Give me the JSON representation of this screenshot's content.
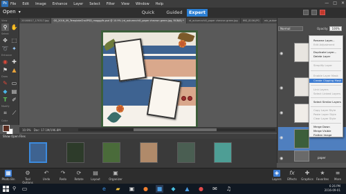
{
  "menubar": {
    "logo_text": "Ps",
    "items": [
      "File",
      "Edit",
      "Image",
      "Enhance",
      "Layer",
      "Select",
      "Filter",
      "View",
      "Window",
      "Help"
    ],
    "window_controls": [
      "—",
      "□",
      "✕"
    ]
  },
  "modebar": {
    "open_label": "Open",
    "tabs": [
      "Quick",
      "Guided",
      "Expert"
    ],
    "active_tab": "Expert"
  },
  "document_tabs": [
    {
      "label": "20160817_170317.jpg",
      "active": false
    },
    {
      "label": "GS_2016_09_TemplateChallPSD_magggifs.psd @ 10.9% (rd_autumnchill_paper chevron green.jpg, RGB/8) *",
      "active": true
    },
    {
      "label": "rd_autumnchill_paper chevron green.jpg",
      "active": false
    },
    {
      "label": "IMG_8106.JPG",
      "active": false
    },
    {
      "label": "mk_autumnoldies_woodso",
      "active": false
    }
  ],
  "toolbox": {
    "sections": [
      "View",
      "Select",
      "Enhance",
      "Draw",
      "Modify",
      "Color"
    ]
  },
  "status": {
    "zoom": "10.9%",
    "doc_info": "Doc: 17.1M/196.8M"
  },
  "layers_panel": {
    "blend_mode": "Normal",
    "opacity_label": "Opacity:",
    "opacity_value": "100%",
    "bottom_layer_name": "paper"
  },
  "context_menu": {
    "items": [
      {
        "label": "Rename Layer...",
        "enabled": true
      },
      {
        "label": "Edit Adjustment",
        "enabled": false
      },
      {
        "label": "Duplicate Layer...",
        "enabled": true
      },
      {
        "label": "Delete Layer",
        "enabled": true
      },
      {
        "label": "Simplify Layer",
        "enabled": false
      },
      {
        "label": "Enable Layer Mask",
        "enabled": false
      },
      {
        "label": "Create Clipping Mask",
        "enabled": true,
        "highlighted": true
      },
      {
        "label": "Link Layers",
        "enabled": false
      },
      {
        "label": "Select Linked Layers",
        "enabled": false
      },
      {
        "label": "Select Similar Layers",
        "enabled": true
      },
      {
        "label": "Copy Layer Style",
        "enabled": false
      },
      {
        "label": "Paste Layer Style",
        "enabled": false
      },
      {
        "label": "Clear Layer Style",
        "enabled": false
      },
      {
        "label": "Merge Down",
        "enabled": true
      },
      {
        "label": "Merge Visible",
        "enabled": true
      },
      {
        "label": "Flatten Image",
        "enabled": true
      }
    ]
  },
  "photo_bin": {
    "dropdown_label": "Show Open Files"
  },
  "bottom_bar": {
    "left": [
      {
        "label": "Photo Bin",
        "icon": "photo-bin-icon",
        "glyph": "▦"
      },
      {
        "label": "Tool Options",
        "icon": "tool-options-icon",
        "glyph": "⚙"
      },
      {
        "label": "Undo",
        "icon": "undo-icon",
        "glyph": "↶"
      },
      {
        "label": "Redo",
        "icon": "redo-icon",
        "glyph": "↷"
      },
      {
        "label": "Rotate",
        "icon": "rotate-icon",
        "glyph": "⟳"
      },
      {
        "label": "Layout",
        "icon": "layout-icon",
        "glyph": "▤"
      },
      {
        "label": "Organizer",
        "icon": "organizer-icon",
        "glyph": "▣"
      }
    ],
    "right": [
      {
        "label": "Layers",
        "icon": "layers-icon",
        "glyph": "◈"
      },
      {
        "label": "Effects",
        "icon": "effects-icon",
        "glyph": "fx"
      },
      {
        "label": "Graphics",
        "icon": "graphics-icon",
        "glyph": "✚"
      },
      {
        "label": "Favorites",
        "icon": "favorites-icon",
        "glyph": "★"
      },
      {
        "label": "More",
        "icon": "more-icon",
        "glyph": "≡"
      }
    ]
  },
  "windows_taskbar": {
    "time": "6:26 PM",
    "date": "2016-09-01"
  },
  "colors": {
    "accent": "#2b7fd4",
    "highlight": "#3c7bd1",
    "foreground_swatch": "#5a2d20"
  }
}
